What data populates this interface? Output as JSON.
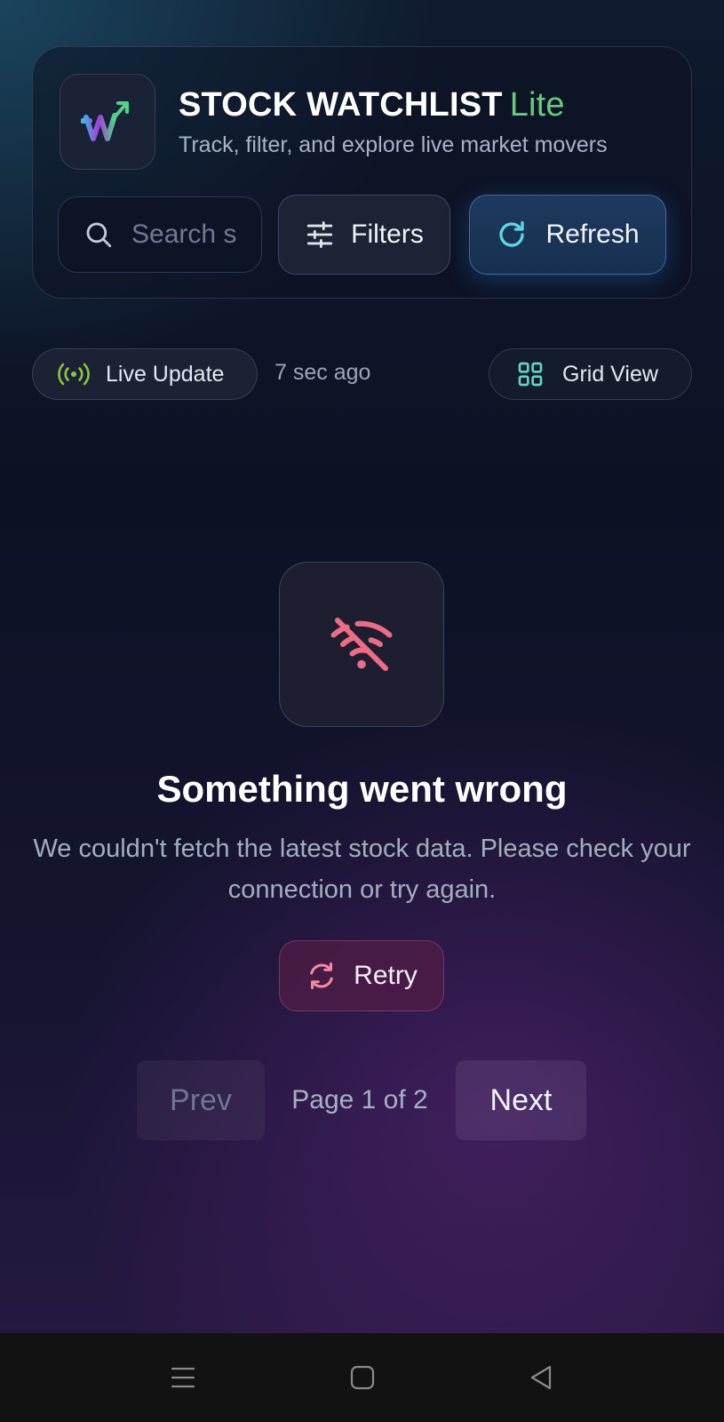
{
  "header": {
    "title": "STOCK WATCHLIST",
    "title_accent": "Lite",
    "subtitle": "Track, filter, and explore live market movers",
    "logo_letter": "W"
  },
  "toolbar": {
    "search_placeholder": "Search s",
    "filters_label": "Filters",
    "refresh_label": "Refresh"
  },
  "status": {
    "live_label": "Live Update",
    "updated_ago": "7 sec ago",
    "view_label": "Grid View"
  },
  "error": {
    "icon": "wifi-off-icon",
    "title": "Something went wrong",
    "message": "We couldn't fetch the latest stock data. Please check your connection or try again.",
    "retry_label": "Retry"
  },
  "pagination": {
    "prev_label": "Prev",
    "page_text": "Page 1 of 2",
    "next_label": "Next"
  },
  "colors": {
    "accent_green": "#66cc7a",
    "accent_cyan": "#5ed6e6",
    "error_pink": "#f06b85",
    "live_green": "#8cc63f"
  }
}
